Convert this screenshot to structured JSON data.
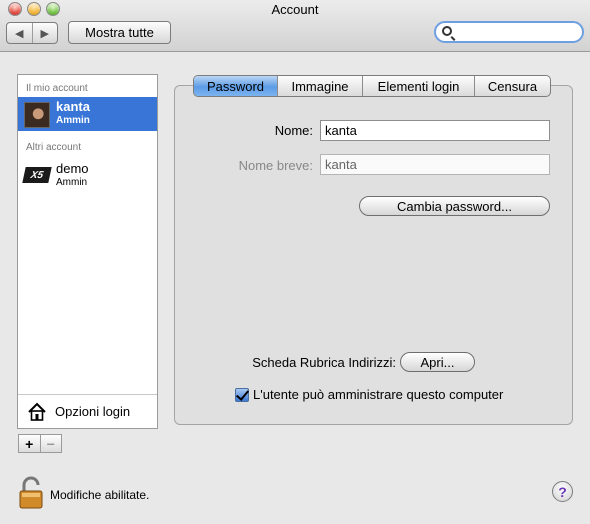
{
  "window": {
    "title": "Account"
  },
  "toolbar": {
    "back_glyph": "◀",
    "forward_glyph": "▶",
    "show_all_label": "Mostra tutte",
    "search_value": ""
  },
  "sidebar": {
    "my_account_header": "Il mio account",
    "other_accounts_header": "Altri account",
    "accounts": [
      {
        "name": "kanta",
        "role": "Ammin",
        "selected": true
      },
      {
        "name": "demo",
        "role": "Ammin",
        "selected": false
      }
    ],
    "demo_logo_text": "X5",
    "login_options_label": "Opzioni login",
    "add_label": "+",
    "remove_label": "−"
  },
  "tabs": [
    {
      "label": "Password",
      "active": true
    },
    {
      "label": "Immagine",
      "active": false
    },
    {
      "label": "Elementi login",
      "active": false
    },
    {
      "label": "Censura",
      "active": false
    }
  ],
  "form": {
    "name_label": "Nome:",
    "name_value": "kanta",
    "short_name_label": "Nome breve:",
    "short_name_value": "kanta",
    "change_password_label": "Cambia password...",
    "address_book_label": "Scheda Rubrica Indirizzi:",
    "open_label": "Apri...",
    "admin_checkbox_label": "L'utente può amministrare questo computer",
    "admin_checked": true
  },
  "footer": {
    "lock_status": "Modifiche abilitate.",
    "help_label": "?"
  },
  "colors": {
    "selection": "#3875d7",
    "active_tab": "#5c9ce6",
    "help_glyph": "#6a38b8"
  }
}
